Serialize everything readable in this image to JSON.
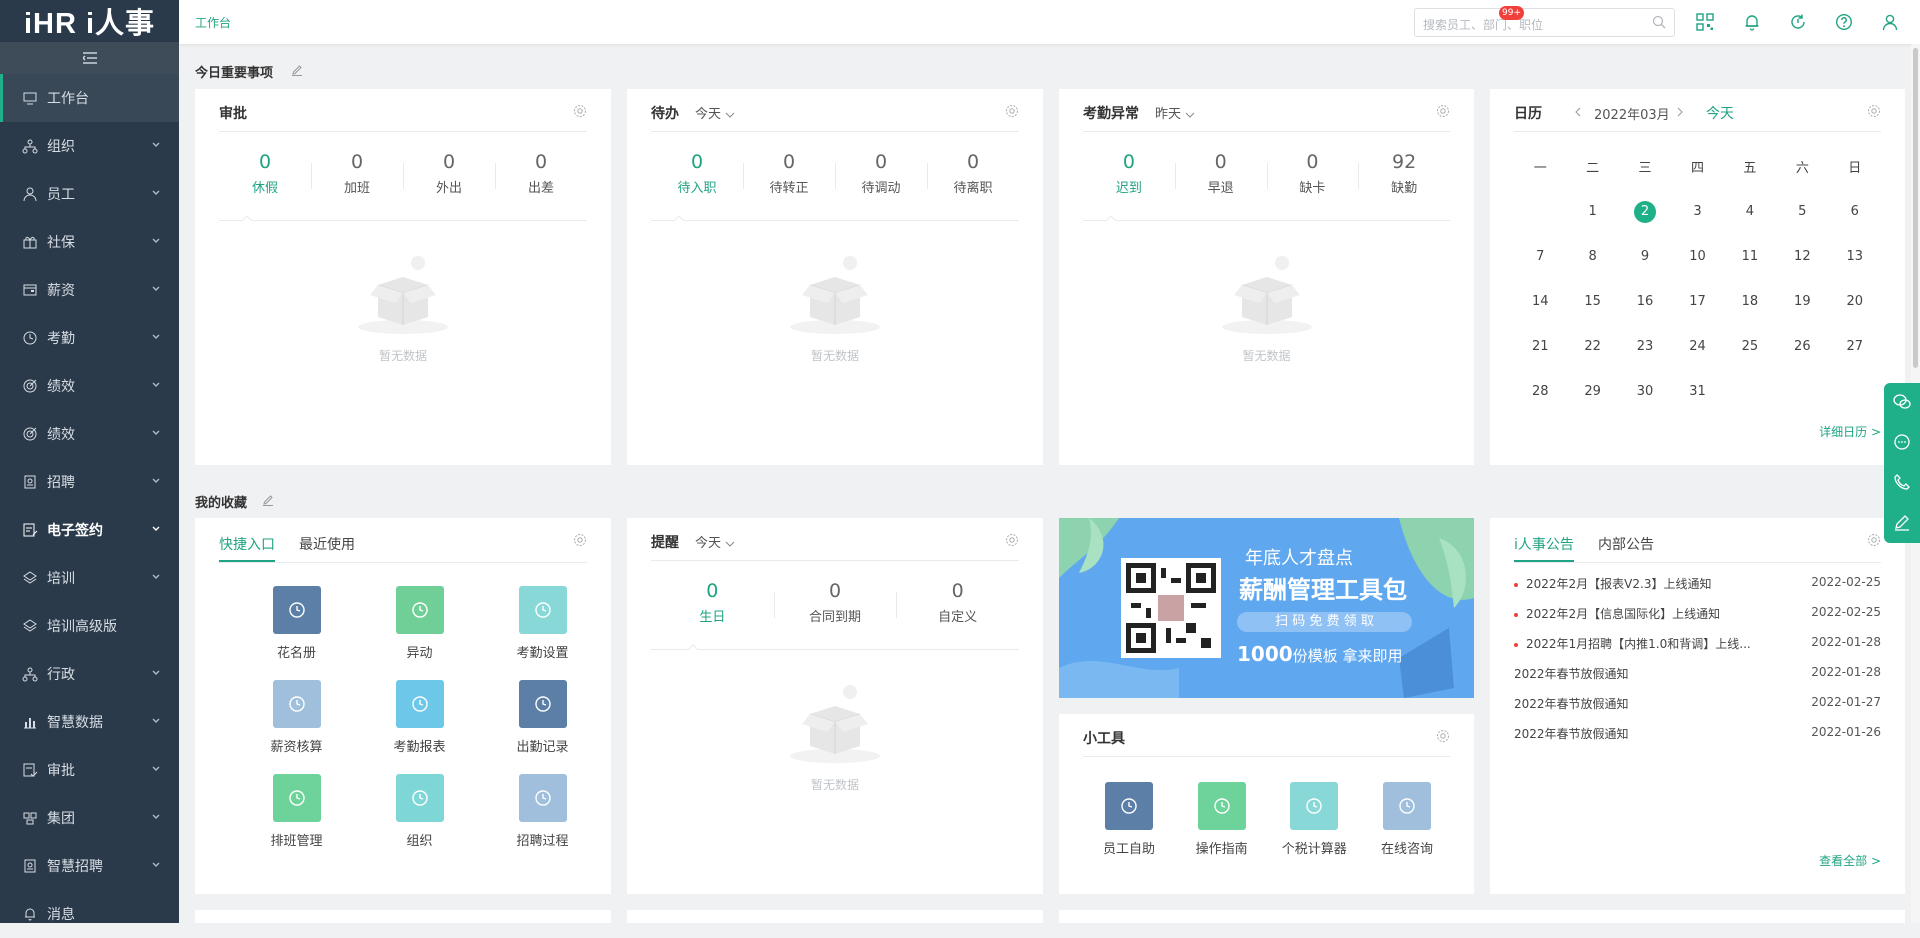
{
  "app": {
    "logo": "iHR i人事"
  },
  "topbar": {
    "breadcrumb": "工作台",
    "search_placeholder": "搜索员工、部门、职位",
    "notification_badge": "99+"
  },
  "sidebar": {
    "items": [
      {
        "label": "工作台",
        "icon": "monitor-icon"
      },
      {
        "label": "组织",
        "icon": "org-icon"
      },
      {
        "label": "员工",
        "icon": "user-icon"
      },
      {
        "label": "社保",
        "icon": "gift-icon"
      },
      {
        "label": "薪资",
        "icon": "wallet-icon"
      },
      {
        "label": "考勤",
        "icon": "clock-icon"
      },
      {
        "label": "绩效",
        "icon": "target-icon"
      },
      {
        "label": "绩效",
        "icon": "target-icon"
      },
      {
        "label": "招聘",
        "icon": "badge-icon"
      },
      {
        "label": "电子签约",
        "icon": "sign-icon"
      },
      {
        "label": "培训",
        "icon": "layers-icon"
      },
      {
        "label": "培训高级版",
        "icon": "layers-icon"
      },
      {
        "label": "行政",
        "icon": "org-icon"
      },
      {
        "label": "智慧数据",
        "icon": "bar-chart-icon"
      },
      {
        "label": "审批",
        "icon": "approve-icon"
      },
      {
        "label": "集团",
        "icon": "group-icon"
      },
      {
        "label": "智慧招聘",
        "icon": "badge-icon"
      },
      {
        "label": "消息",
        "icon": "bell-icon"
      }
    ]
  },
  "today": {
    "title": "今日重要事项",
    "approval": {
      "title": "审批",
      "stats": [
        {
          "num": "0",
          "label": "休假"
        },
        {
          "num": "0",
          "label": "加班"
        },
        {
          "num": "0",
          "label": "外出"
        },
        {
          "num": "0",
          "label": "出差"
        }
      ],
      "empty": "暂无数据"
    },
    "todo": {
      "title": "待办",
      "dropdown": "今天",
      "stats": [
        {
          "num": "0",
          "label": "待入职"
        },
        {
          "num": "0",
          "label": "待转正"
        },
        {
          "num": "0",
          "label": "待调动"
        },
        {
          "num": "0",
          "label": "待离职"
        }
      ],
      "empty": "暂无数据"
    },
    "attendance": {
      "title": "考勤异常",
      "dropdown": "昨天",
      "stats": [
        {
          "num": "0",
          "label": "迟到"
        },
        {
          "num": "0",
          "label": "早退"
        },
        {
          "num": "0",
          "label": "缺卡"
        },
        {
          "num": "92",
          "label": "缺勤"
        }
      ],
      "empty": "暂无数据"
    },
    "calendar": {
      "title": "日历",
      "month": "2022年03月",
      "today_btn": "今天",
      "weekdays": [
        "一",
        "二",
        "三",
        "四",
        "五",
        "六",
        "日"
      ],
      "today": "2",
      "detail_link": "详细日历 >"
    }
  },
  "favorites": {
    "title": "我的收藏",
    "tabs": [
      "快捷入口",
      "最近使用"
    ],
    "items": [
      {
        "label": "花名册",
        "color": "#5b7fa6"
      },
      {
        "label": "异动",
        "color": "#6fcf97"
      },
      {
        "label": "考勤设置",
        "color": "#88d8d8"
      },
      {
        "label": "薪资核算",
        "color": "#9fbfdc"
      },
      {
        "label": "考勤报表",
        "color": "#6cc7e8"
      },
      {
        "label": "出勤记录",
        "color": "#5b7fa6"
      },
      {
        "label": "排班管理",
        "color": "#6dd39a"
      },
      {
        "label": "组织",
        "color": "#7fd6d6"
      },
      {
        "label": "招聘过程",
        "color": "#9fbfdc"
      }
    ]
  },
  "reminder": {
    "title": "提醒",
    "dropdown": "今天",
    "stats": [
      {
        "num": "0",
        "label": "生日"
      },
      {
        "num": "0",
        "label": "合同到期"
      },
      {
        "num": "0",
        "label": "自定义"
      }
    ],
    "empty": "暂无数据"
  },
  "banner": {
    "line1": "年底人才盘点",
    "line2": "薪酬管理工具包",
    "pill": "扫 码 免 费 领 取",
    "num": "1000",
    "line4": "份模板 拿来即用"
  },
  "tools": {
    "title": "小工具",
    "items": [
      {
        "label": "员工自助",
        "color": "#5b7fa6"
      },
      {
        "label": "操作指南",
        "color": "#6dd39a"
      },
      {
        "label": "个税计算器",
        "color": "#88d8d8"
      },
      {
        "label": "在线咨询",
        "color": "#9fbfdc"
      }
    ]
  },
  "notices": {
    "tabs": [
      "i人事公告",
      "内部公告"
    ],
    "items": [
      {
        "title": "2022年2月【报表V2.3】上线通知",
        "date": "2022-02-25",
        "hot": true
      },
      {
        "title": "2022年2月【信息国际化】上线通知",
        "date": "2022-02-25",
        "hot": true
      },
      {
        "title": "2022年1月招聘【内推1.0和背调】上线...",
        "date": "2022-01-28",
        "hot": true
      },
      {
        "title": "2022年春节放假通知",
        "date": "2022-01-28",
        "hot": false
      },
      {
        "title": "2022年春节放假通知",
        "date": "2022-01-27",
        "hot": false
      },
      {
        "title": "2022年春节放假通知",
        "date": "2022-01-26",
        "hot": false
      }
    ],
    "more": "查看全部 >"
  },
  "colors": {
    "accent": "#20a383",
    "sidebar": "#2b3a4a",
    "badge": "#f1403c"
  }
}
